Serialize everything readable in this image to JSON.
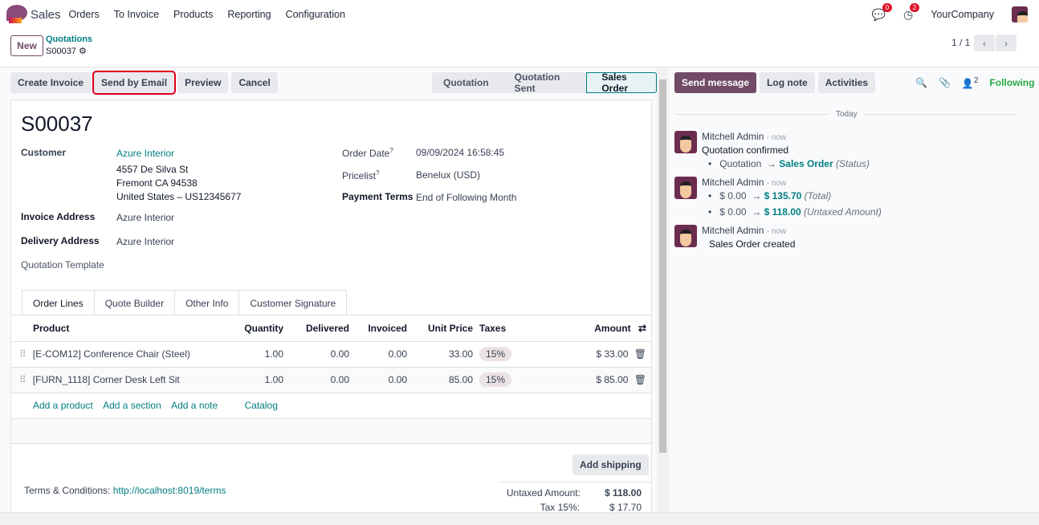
{
  "navbar": {
    "app": "Sales",
    "menu": [
      "Orders",
      "To Invoice",
      "Products",
      "Reporting",
      "Configuration"
    ],
    "messages_badge": "0",
    "activities_badge": "2",
    "company": "YourCompany"
  },
  "control": {
    "new_label": "New",
    "breadcrumb_parent": "Quotations",
    "breadcrumb_current": "S00037",
    "pager": "1 / 1"
  },
  "actions": {
    "create_invoice": "Create Invoice",
    "send_email": "Send by Email",
    "preview": "Preview",
    "cancel": "Cancel"
  },
  "status": {
    "steps": [
      "Quotation",
      "Quotation Sent",
      "Sales Order"
    ],
    "active": "Sales Order"
  },
  "form": {
    "name": "S00037",
    "customer_label": "Customer",
    "customer": "Azure Interior",
    "address": [
      "4557 De Silva St",
      "Fremont CA 94538",
      "United States – US12345677"
    ],
    "invoice_address_label": "Invoice Address",
    "invoice_address": "Azure Interior",
    "delivery_address_label": "Delivery Address",
    "delivery_address": "Azure Interior",
    "template_label": "Quotation Template",
    "order_date_label": "Order Date",
    "order_date": "09/09/2024 16:58:45",
    "pricelist_label": "Pricelist",
    "pricelist": "Benelux (USD)",
    "payment_terms_label": "Payment Terms",
    "payment_terms": "End of Following Month"
  },
  "tabs": [
    "Order Lines",
    "Quote Builder",
    "Other Info",
    "Customer Signature"
  ],
  "lines": {
    "headers": [
      "Product",
      "Quantity",
      "Delivered",
      "Invoiced",
      "Unit Price",
      "Taxes",
      "Amount"
    ],
    "rows": [
      {
        "product": "[E-COM12] Conference Chair (Steel)",
        "qty": "1.00",
        "delivered": "0.00",
        "invoiced": "0.00",
        "price": "33.00",
        "tax": "15%",
        "amount": "$ 33.00"
      },
      {
        "product": "[FURN_1118] Corner Desk Left Sit",
        "qty": "1.00",
        "delivered": "0.00",
        "invoiced": "0.00",
        "price": "85.00",
        "tax": "15%",
        "amount": "$ 85.00"
      }
    ],
    "add_product": "Add a product",
    "add_section": "Add a section",
    "add_note": "Add a note",
    "catalog": "Catalog"
  },
  "footer": {
    "add_shipping": "Add shipping",
    "terms_label": "Terms & Conditions:",
    "terms_link": "http://localhost:8019/terms",
    "untaxed_label": "Untaxed Amount:",
    "untaxed": "$ 118.00",
    "tax_label": "Tax 15%:",
    "tax": "$ 17.70"
  },
  "chatter": {
    "send_message": "Send message",
    "log_note": "Log note",
    "activities": "Activities",
    "followers_count": "2",
    "following": "Following",
    "date_sep": "Today",
    "messages": [
      {
        "author": "Mitchell Admin",
        "time": "- now",
        "body": "Quotation confirmed",
        "changes": [
          {
            "old": "Quotation",
            "new": "Sales Order",
            "field": "(Status)"
          }
        ]
      },
      {
        "author": "Mitchell Admin",
        "time": "- now",
        "body": "",
        "changes": [
          {
            "old": "$ 0.00",
            "new": "$ 135.70",
            "field": "(Total)"
          },
          {
            "old": "$ 0.00",
            "new": "$ 118.00",
            "field": "(Untaxed Amount)"
          }
        ]
      },
      {
        "author": "Mitchell Admin",
        "time": "- now",
        "body": "Sales Order created",
        "changes": []
      }
    ]
  },
  "colors": {
    "brand": "#714b67",
    "link": "#017e84",
    "following": "#28a745",
    "badge": "#e0142a",
    "highlight": "#e0001a"
  }
}
